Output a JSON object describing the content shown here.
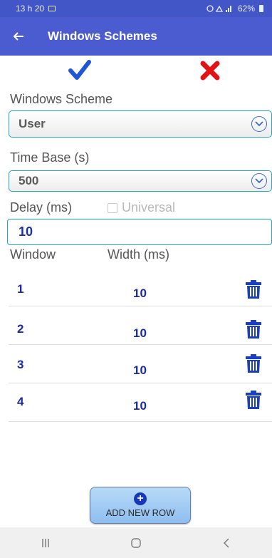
{
  "status_bar": {
    "time": "13 h 20",
    "battery": "62%"
  },
  "app_bar": {
    "title": "Windows Schemes"
  },
  "form": {
    "scheme_label": "Windows Scheme",
    "scheme_value": "User",
    "time_base_label": "Time Base (s)",
    "time_base_value": "500",
    "delay_label": "Delay (ms)",
    "universal_label": "Universal",
    "universal_checked": false,
    "delay_value": "10"
  },
  "table": {
    "headers": {
      "window": "Window",
      "width": "Width (ms)"
    },
    "rows": [
      {
        "window": "1",
        "width": "10"
      },
      {
        "window": "2",
        "width": "10"
      },
      {
        "window": "3",
        "width": "10"
      },
      {
        "window": "4",
        "width": "10"
      }
    ]
  },
  "add_button": {
    "label": "ADD NEW ROW"
  },
  "colors": {
    "accent": "#4b5cd0",
    "confirm": "#1f55d6",
    "cancel": "#e01414",
    "field_border": "#1ea4c9",
    "value_text": "#1a2aa8"
  },
  "icons": [
    "back-arrow-icon",
    "check-icon",
    "close-icon",
    "chevron-down-icon",
    "trash-icon",
    "plus-icon"
  ]
}
